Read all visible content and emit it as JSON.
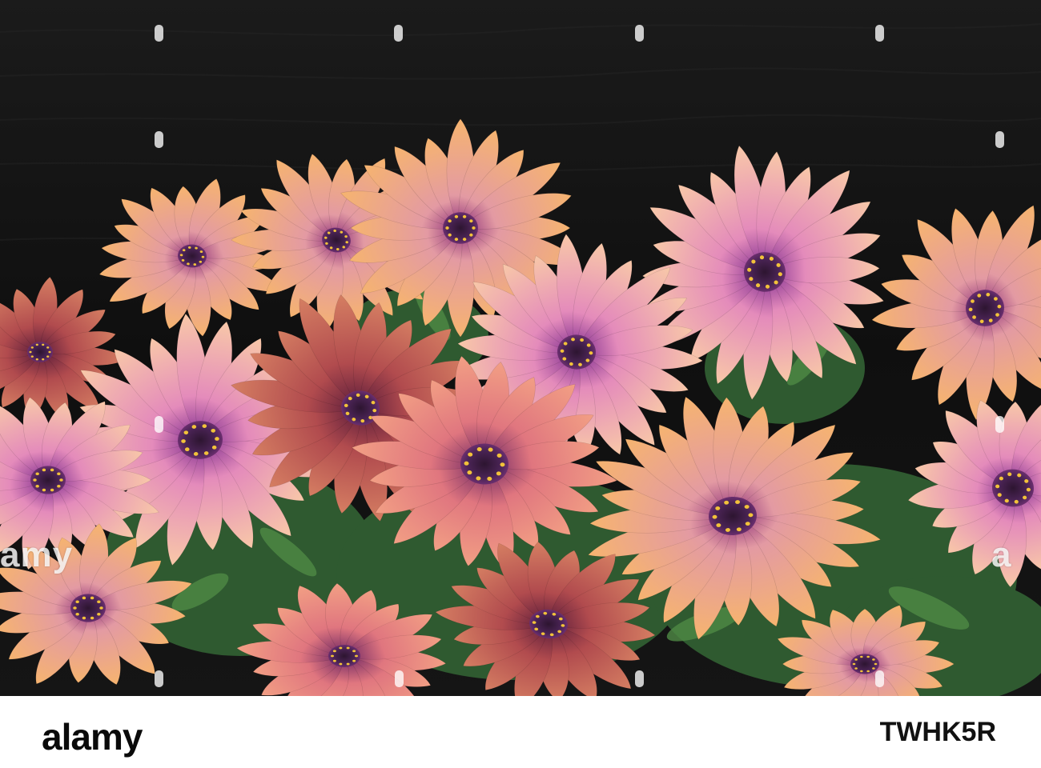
{
  "watermark": {
    "brand": "alamy",
    "edge_left": "amy",
    "edge_right": "a"
  },
  "footer": {
    "logo": "alamy",
    "image_id": "TWHK5R"
  },
  "colors": {
    "background_wood": "#121212",
    "petal_pink": "#f2a6b4",
    "petal_orange": "#f3b073",
    "petal_red": "#b24a45",
    "center_purple": "#3a1d46",
    "leaf_green": "#3b6f3c"
  }
}
